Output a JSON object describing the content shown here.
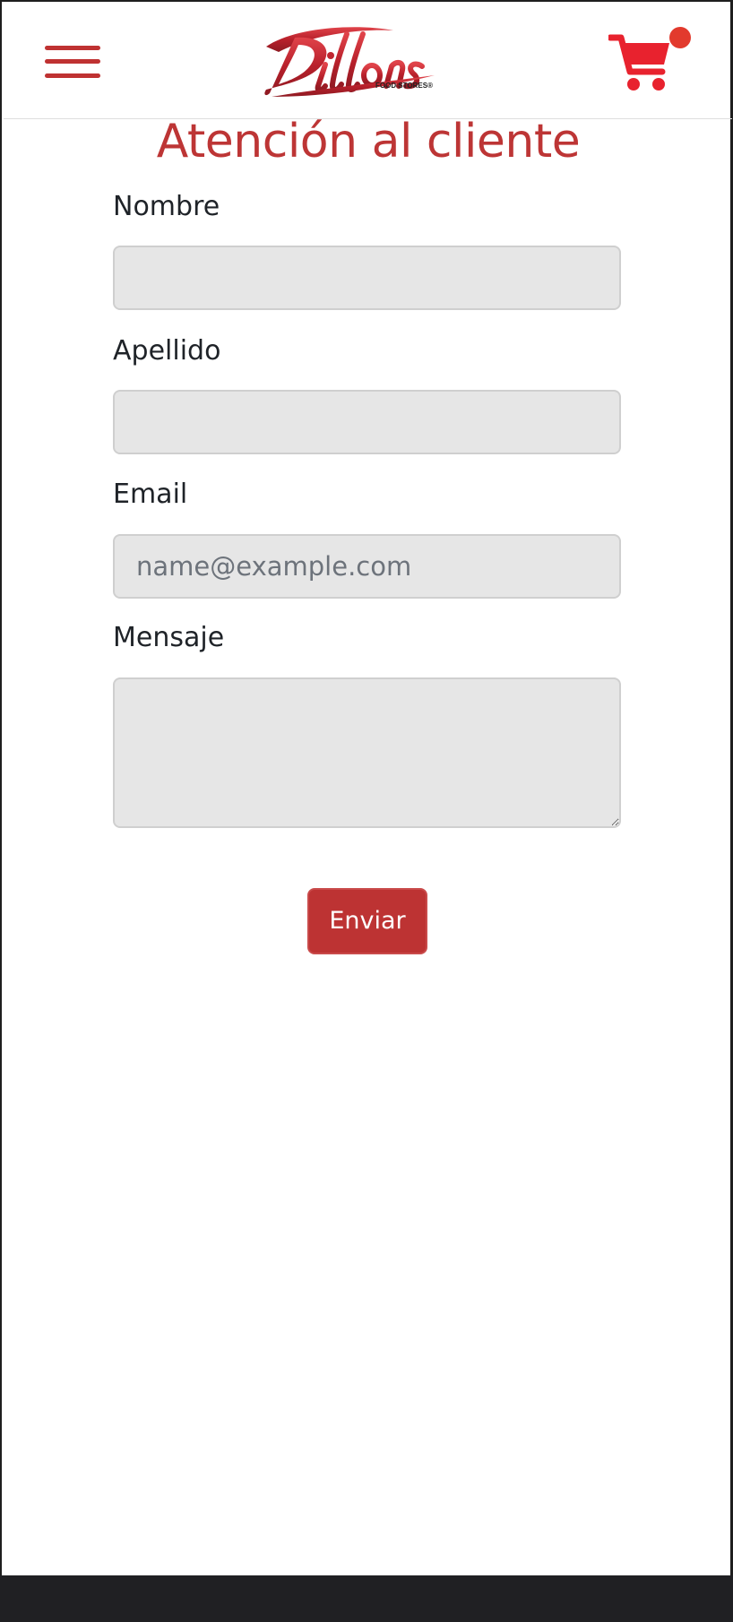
{
  "header": {
    "brand_name": "Dillons",
    "brand_tagline": "FOOD STORES®",
    "menu_icon": "hamburger-menu-icon",
    "cart_icon": "shopping-cart-icon",
    "accent_color": "#bd3535",
    "cart_icon_color": "#e8222e",
    "cart_badge_color": "#e23a2d"
  },
  "page": {
    "title": "Atención al cliente"
  },
  "form": {
    "first_name_label": "Nombre",
    "first_name_value": "",
    "last_name_label": "Apellido",
    "last_name_value": "",
    "email_label": "Email",
    "email_placeholder": "name@example.com",
    "email_value": "",
    "message_label": "Mensaje",
    "message_value": "",
    "submit_label": "Enviar",
    "field_background": "#e6e6e6"
  }
}
